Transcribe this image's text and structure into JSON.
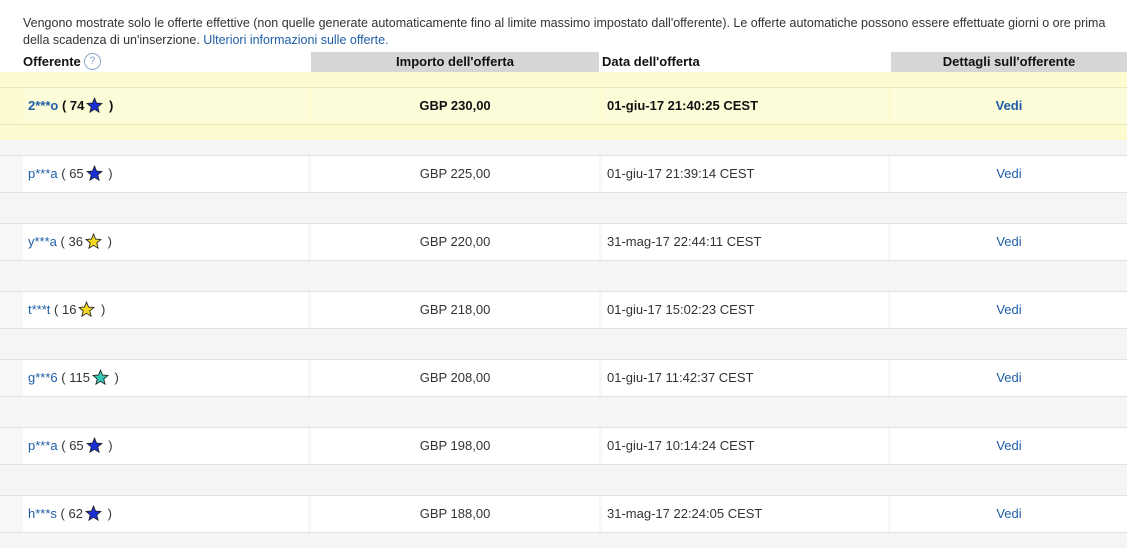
{
  "note": {
    "line1": "Vengono mostrate solo le offerte effettive (non quelle generate automaticamente fino al limite massimo impostato dall'offerente). Le offerte automatiche possono essere effettuate giorni o ore prima",
    "line2_text": "della scadenza di un'inserzione.",
    "more_info_link": "Ulteriori informazioni sulle offerte."
  },
  "table": {
    "headers": {
      "bidder": "Offerente",
      "amount": "Importo dell'offerta",
      "date": "Data dell'offerta",
      "details": "Dettagli sull'offerente"
    },
    "help_icon": "?",
    "rows": [
      {
        "bidder": "2***o",
        "score": "74",
        "star_color": "#1a2fd6",
        "star_icon": "blue-star-icon",
        "amount": "GBP 230,00",
        "date": "01-giu-17 21:40:25 CEST",
        "details": "Vedi",
        "highlighted": true
      },
      {
        "bidder": "p***a",
        "score": "65",
        "star_color": "#1a2fd6",
        "star_icon": "blue-star-icon",
        "amount": "GBP 225,00",
        "date": "01-giu-17 21:39:14 CEST",
        "details": "Vedi",
        "highlighted": false
      },
      {
        "bidder": "y***a",
        "score": "36",
        "star_color": "#f5d820",
        "star_icon": "yellow-star-icon",
        "amount": "GBP 220,00",
        "date": "31-mag-17 22:44:11 CEST",
        "details": "Vedi",
        "highlighted": false
      },
      {
        "bidder": "t***t",
        "score": "16",
        "star_color": "#f5d820",
        "star_icon": "yellow-star-icon",
        "amount": "GBP 218,00",
        "date": "01-giu-17 15:02:23 CEST",
        "details": "Vedi",
        "highlighted": false
      },
      {
        "bidder": "g***6",
        "score": "115",
        "star_color": "#33c9b8",
        "star_icon": "turquoise-star-icon",
        "amount": "GBP 208,00",
        "date": "01-giu-17 11:42:37 CEST",
        "details": "Vedi",
        "highlighted": false
      },
      {
        "bidder": "p***a",
        "score": "65",
        "star_color": "#1a2fd6",
        "star_icon": "blue-star-icon",
        "amount": "GBP 198,00",
        "date": "01-giu-17 10:14:24 CEST",
        "details": "Vedi",
        "highlighted": false
      },
      {
        "bidder": "h***s",
        "score": "62",
        "star_color": "#1a2fd6",
        "star_icon": "blue-star-icon",
        "amount": "GBP 188,00",
        "date": "31-mag-17 22:24:05 CEST",
        "details": "Vedi",
        "highlighted": false
      }
    ]
  }
}
